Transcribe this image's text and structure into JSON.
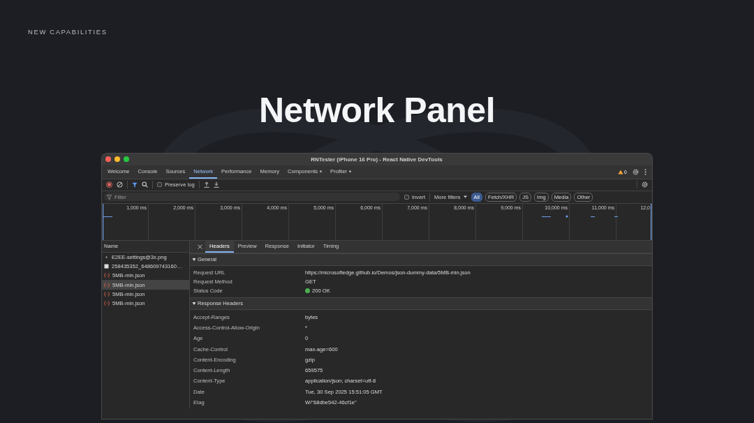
{
  "eyebrow": "NEW CAPABILITIES",
  "heading": "Network Panel",
  "window": {
    "title": "RNTester (iPhone 16 Pro) - React Native DevTools"
  },
  "tabs": [
    {
      "label": "Welcome",
      "selected": false,
      "dot": false
    },
    {
      "label": "Console",
      "selected": false,
      "dot": false
    },
    {
      "label": "Sources",
      "selected": false,
      "dot": false
    },
    {
      "label": "Network",
      "selected": true,
      "dot": false
    },
    {
      "label": "Performance",
      "selected": false,
      "dot": false
    },
    {
      "label": "Memory",
      "selected": false,
      "dot": false
    },
    {
      "label": "Components",
      "selected": false,
      "dot": true
    },
    {
      "label": "Profiler",
      "selected": false,
      "dot": true
    }
  ],
  "warnings": "6",
  "toolbar": {
    "recording": true,
    "filter_active": true,
    "preserve_log": {
      "label": "Preserve log",
      "checked": false
    }
  },
  "filter": {
    "placeholder": "Filter",
    "invert": {
      "label": "Invert",
      "checked": false
    },
    "more_filters": "More filters",
    "types": [
      {
        "label": "All",
        "selected": true
      },
      {
        "label": "Fetch/XHR",
        "selected": false
      },
      {
        "label": "JS",
        "selected": false
      },
      {
        "label": "Img",
        "selected": false
      },
      {
        "label": "Media",
        "selected": false
      },
      {
        "label": "Other",
        "selected": false
      }
    ]
  },
  "timeline": {
    "ticks": [
      "1,000 ms",
      "2,000 ms",
      "3,000 ms",
      "4,000 ms",
      "5,000 ms",
      "6,000 ms",
      "7,000 ms",
      "8,000 ms",
      "9,000 ms",
      "10,000 ms",
      "11,000 ms",
      "12,0"
    ]
  },
  "requests": {
    "column": "Name",
    "rows": [
      {
        "name": "E2EE-settings@3x.png",
        "kind": "dot",
        "selected": false
      },
      {
        "name": "258435352_648609743160…",
        "kind": "image",
        "selected": false
      },
      {
        "name": "5MB-min.json",
        "kind": "json",
        "selected": false
      },
      {
        "name": "5MB-min.json",
        "kind": "json",
        "selected": true
      },
      {
        "name": "5MB-min.json",
        "kind": "json",
        "selected": false
      },
      {
        "name": "5MB-min.json",
        "kind": "json",
        "selected": false
      }
    ]
  },
  "details": {
    "tabs": [
      {
        "label": "Headers",
        "selected": true
      },
      {
        "label": "Preview",
        "selected": false
      },
      {
        "label": "Response",
        "selected": false
      },
      {
        "label": "Initiator",
        "selected": false
      },
      {
        "label": "Timing",
        "selected": false
      }
    ],
    "sections": [
      {
        "title": "General",
        "expanded": true,
        "rows": [
          {
            "key": "Request URL",
            "value": "https://microsoftedge.github.io/Demos/json-dummy-data/5MB-min.json"
          },
          {
            "key": "Request Method",
            "value": "GET"
          },
          {
            "key": "Status Code",
            "value": "200 OK",
            "color": "#4caf50"
          }
        ]
      },
      {
        "title": "Response Headers",
        "expanded": true,
        "rows": [
          {
            "key": "Accept-Ranges",
            "value": "bytes"
          },
          {
            "key": "Access-Control-Allow-Origin",
            "value": "*"
          },
          {
            "key": "Age",
            "value": "0"
          },
          {
            "key": "Cache-Control",
            "value": "max-age=600"
          },
          {
            "key": "Content-Encoding",
            "value": "gzip"
          },
          {
            "key": "Content-Length",
            "value": "659575"
          },
          {
            "key": "Content-Type",
            "value": "application/json; charset=utf-8"
          },
          {
            "key": "Date",
            "value": "Tue, 30 Sep 2025 15:51:05 GMT"
          },
          {
            "key": "Etag",
            "value": "W/\"68dbe542-46cf1e\""
          }
        ]
      }
    ]
  }
}
